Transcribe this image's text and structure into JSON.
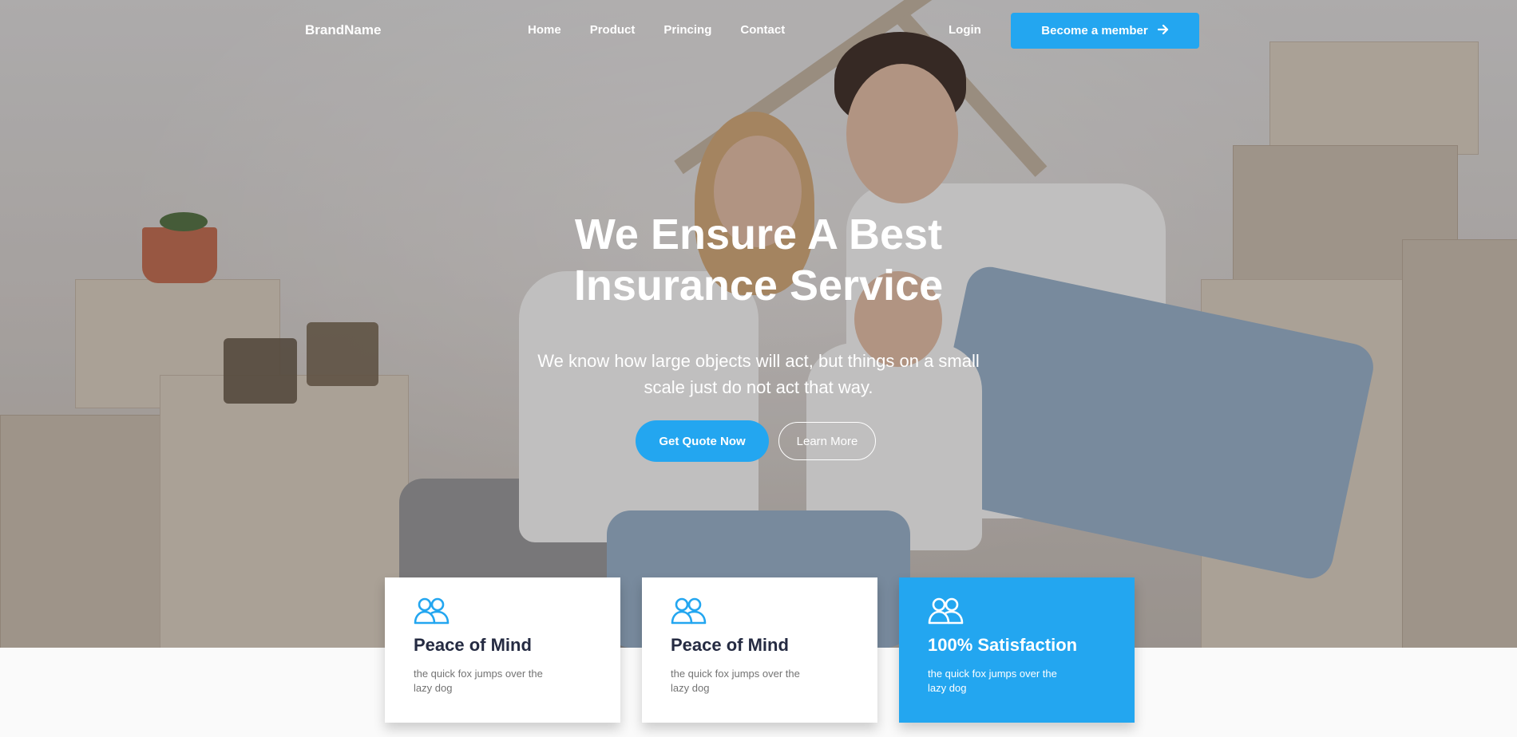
{
  "nav": {
    "brand": "BrandName",
    "links": [
      "Home",
      "Product",
      "Princing",
      "Contact"
    ],
    "login": "Login",
    "cta": "Become a member",
    "cta_icon": "arrow-right-icon"
  },
  "hero": {
    "headline_1": "We Ensure A Best",
    "headline_2": "Insurance Service",
    "subline": "We know how large objects will act, but things on a small scale just do not act that way.",
    "primary_button": "Get Quote Now",
    "secondary_button": "Learn More"
  },
  "features": [
    {
      "icon": "users-icon",
      "title": "Peace of Mind",
      "desc": "the quick fox jumps over the lazy dog"
    },
    {
      "icon": "users-icon",
      "title": "Peace of Mind",
      "desc": "the quick fox jumps over the lazy dog"
    },
    {
      "icon": "users-icon",
      "title": "100% Satisfaction",
      "desc": "the quick fox jumps over the lazy dog"
    }
  ],
  "colors": {
    "accent": "#23a6f0",
    "heading": "#252b42",
    "muted": "#737373"
  }
}
